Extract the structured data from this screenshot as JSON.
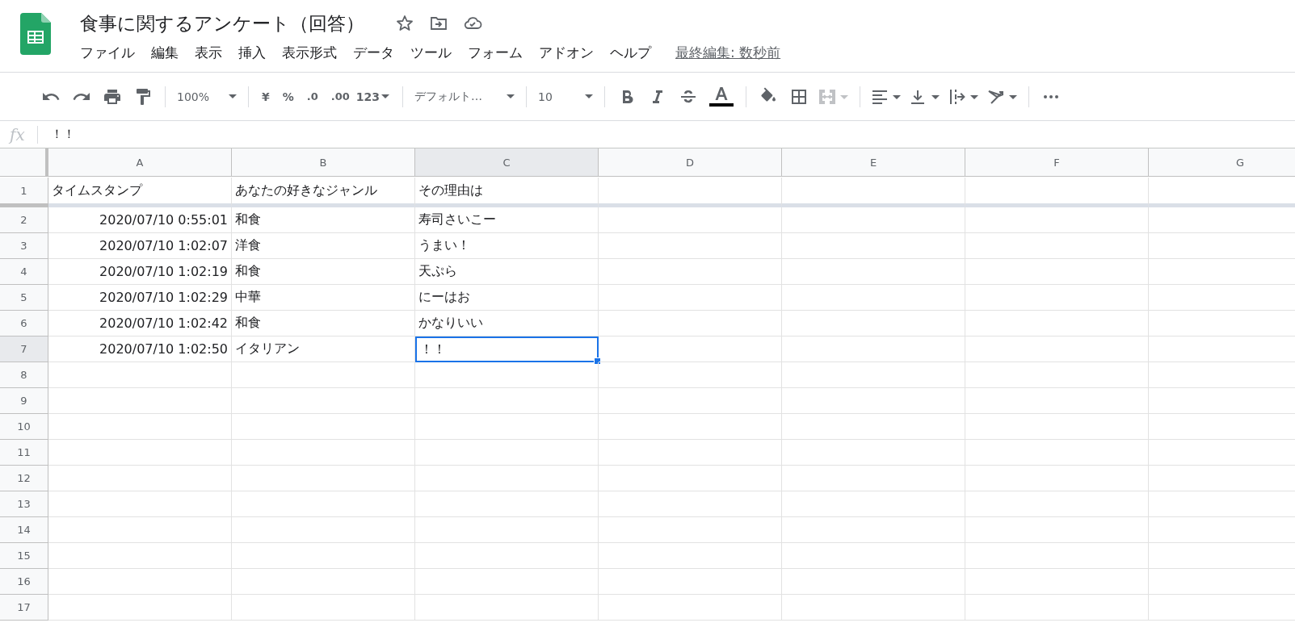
{
  "document": {
    "title": "食事に関するアンケート（回答）",
    "last_edit": "最終編集: 数秒前"
  },
  "menu": [
    "ファイル",
    "編集",
    "表示",
    "挿入",
    "表示形式",
    "データ",
    "ツール",
    "フォーム",
    "アドオン",
    "ヘルプ"
  ],
  "toolbar": {
    "zoom": "100%",
    "currency": "¥",
    "percent": "%",
    "decrease_decimal": ".0",
    "increase_decimal": ".00",
    "number_format": "123",
    "font": "デフォルト…",
    "font_size": "10"
  },
  "formula_bar": {
    "label": "fx",
    "value": "！！"
  },
  "columns": [
    {
      "label": "A",
      "selected": false
    },
    {
      "label": "B",
      "selected": false
    },
    {
      "label": "C",
      "selected": true
    },
    {
      "label": "D",
      "selected": false
    },
    {
      "label": "E",
      "selected": false
    },
    {
      "label": "F",
      "selected": false
    },
    {
      "label": "G",
      "selected": false
    }
  ],
  "rows": [
    {
      "number": "1",
      "selected": false,
      "cells": [
        {
          "text": "タイムスタンプ",
          "kind": "text",
          "selected": false
        },
        {
          "text": "あなたの好きなジャンル",
          "kind": "text",
          "selected": false
        },
        {
          "text": "その理由は",
          "kind": "text",
          "selected": false
        }
      ]
    },
    {
      "number": "2",
      "selected": false,
      "cells": [
        {
          "text": "2020/07/10 0:55:01",
          "kind": "date",
          "selected": false
        },
        {
          "text": "和食",
          "kind": "text",
          "selected": false
        },
        {
          "text": "寿司さいこー",
          "kind": "text",
          "selected": false
        }
      ]
    },
    {
      "number": "3",
      "selected": false,
      "cells": [
        {
          "text": "2020/07/10 1:02:07",
          "kind": "date",
          "selected": false
        },
        {
          "text": "洋食",
          "kind": "text",
          "selected": false
        },
        {
          "text": "うまい！",
          "kind": "text",
          "selected": false
        }
      ]
    },
    {
      "number": "4",
      "selected": false,
      "cells": [
        {
          "text": "2020/07/10 1:02:19",
          "kind": "date",
          "selected": false
        },
        {
          "text": "和食",
          "kind": "text",
          "selected": false
        },
        {
          "text": "天ぷら",
          "kind": "text",
          "selected": false
        }
      ]
    },
    {
      "number": "5",
      "selected": false,
      "cells": [
        {
          "text": "2020/07/10 1:02:29",
          "kind": "date",
          "selected": false
        },
        {
          "text": "中華",
          "kind": "text",
          "selected": false
        },
        {
          "text": "にーはお",
          "kind": "text",
          "selected": false
        }
      ]
    },
    {
      "number": "6",
      "selected": false,
      "cells": [
        {
          "text": "2020/07/10 1:02:42",
          "kind": "date",
          "selected": false
        },
        {
          "text": "和食",
          "kind": "text",
          "selected": false
        },
        {
          "text": "かなりいい",
          "kind": "text",
          "selected": false
        }
      ]
    },
    {
      "number": "7",
      "selected": true,
      "cells": [
        {
          "text": "2020/07/10 1:02:50",
          "kind": "date",
          "selected": false
        },
        {
          "text": "イタリアン",
          "kind": "text",
          "selected": false
        },
        {
          "text": "！！",
          "kind": "text",
          "selected": true
        }
      ]
    },
    {
      "number": "8",
      "selected": false
    },
    {
      "number": "9",
      "selected": false
    },
    {
      "number": "10",
      "selected": false
    },
    {
      "number": "11",
      "selected": false
    },
    {
      "number": "12",
      "selected": false
    },
    {
      "number": "13",
      "selected": false
    },
    {
      "number": "14",
      "selected": false
    },
    {
      "number": "15",
      "selected": false
    },
    {
      "number": "16",
      "selected": false
    },
    {
      "number": "17",
      "selected": false
    }
  ]
}
